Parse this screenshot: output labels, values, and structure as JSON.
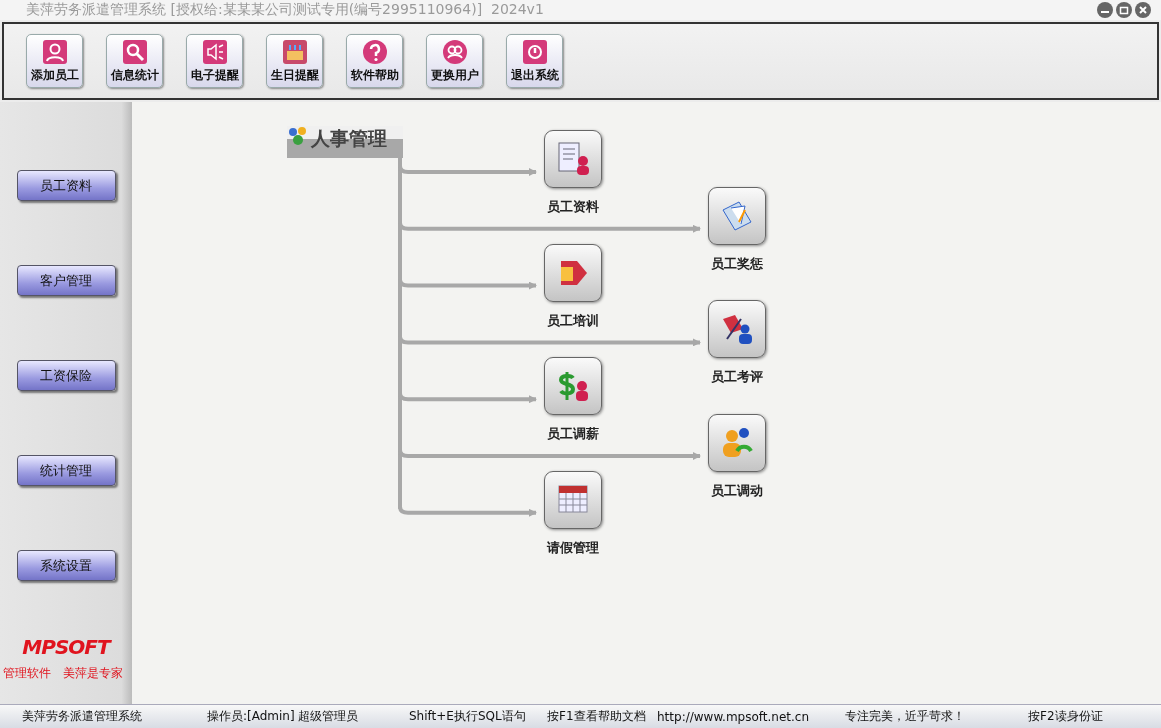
{
  "window": {
    "title": "美萍劳务派遣管理系统 [授权给:某某某公司测试专用(编号2995110964)]  2024v1"
  },
  "toolbar": [
    {
      "label": "添加员工"
    },
    {
      "label": "信息统计"
    },
    {
      "label": "电子提醒"
    },
    {
      "label": "生日提醒"
    },
    {
      "label": "软件帮助"
    },
    {
      "label": "更换用户"
    },
    {
      "label": "退出系统"
    }
  ],
  "sidebar": {
    "items": [
      "员工资料",
      "客户管理",
      "工资保险",
      "统计管理",
      "系统设置"
    ],
    "logo": "MPSOFT",
    "slogan_1": "管理软件",
    "slogan_2": "美萍是专家"
  },
  "diagram": {
    "title": "人事管理",
    "nodes": [
      "员工资料",
      "员工奖惩",
      "员工培训",
      "员工考评",
      "员工调薪",
      "员工调动",
      "请假管理"
    ]
  },
  "status_bar": [
    "美萍劳务派遣管理系统",
    "操作员:[Admin] 超级管理员",
    "Shift+E执行SQL语句",
    "按F1查看帮助文档",
    "http://www.mpsoft.net.cn",
    "专注完美，近乎苛求！",
    "按F2读身份证"
  ]
}
